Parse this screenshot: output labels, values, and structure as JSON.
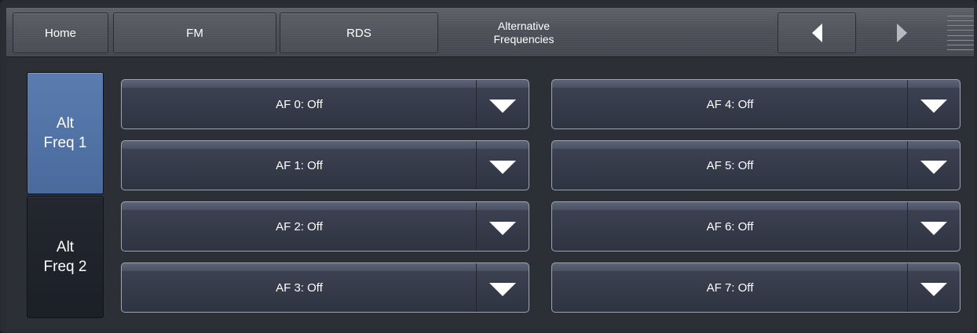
{
  "nav": {
    "home": "Home",
    "fm": "FM",
    "rds": "RDS",
    "title_line1": "Alternative",
    "title_line2": "Frequencies"
  },
  "side": {
    "alt1_line1": "Alt",
    "alt1_line2": "Freq 1",
    "alt2_line1": "Alt",
    "alt2_line2": "Freq 2",
    "active_color": "#5473a6"
  },
  "af": {
    "items": [
      "AF 0: Off",
      "AF 1: Off",
      "AF 2: Off",
      "AF 3: Off",
      "AF 4: Off",
      "AF 5: Off",
      "AF 6: Off",
      "AF 7: Off"
    ]
  },
  "icons": {
    "prev": "arrow-left-icon",
    "next": "arrow-right-icon",
    "menu": "menu-grip-icon",
    "dropdown": "caret-down-icon"
  }
}
